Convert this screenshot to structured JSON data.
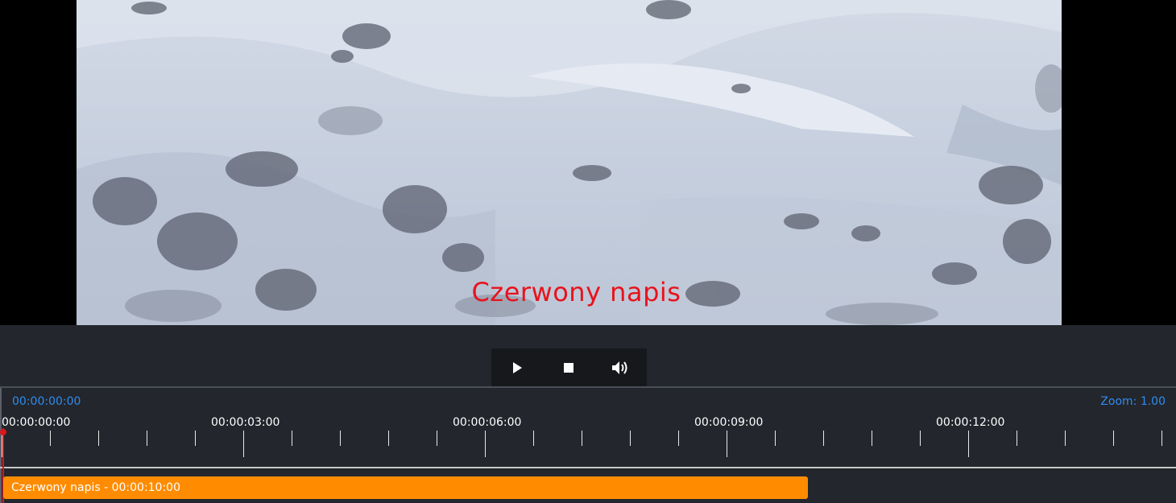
{
  "video": {
    "caption": "Czerwony napis",
    "caption_color": "#e8131c"
  },
  "controls": {
    "play_icon": "play-icon",
    "stop_icon": "stop-icon",
    "volume_icon": "volume-icon"
  },
  "timeline": {
    "current_time": "00:00:00:00",
    "zoom_label": "Zoom: 1.00",
    "major_ticks": [
      "00:00:00:00",
      "00:00:03:00",
      "00:00:06:00",
      "00:00:09:00",
      "00:00:12:00"
    ],
    "clip_label": "Czerwony napis - 00:00:10:00",
    "clip_color": "#ff8c00",
    "playhead_color": "#e0141c",
    "accent_color": "#2f8cf0"
  }
}
